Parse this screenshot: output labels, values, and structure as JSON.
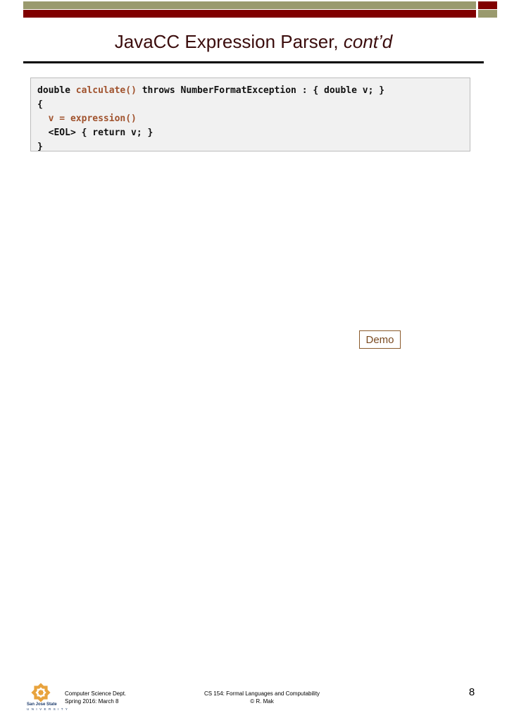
{
  "slide": {
    "title_main": "JavaCC Expression Parser, ",
    "title_italic": "cont’d",
    "page_number": "8"
  },
  "banner": {
    "olive_color": "#9a9a6e",
    "maroon_color": "#800000"
  },
  "code": {
    "line1_a": "double ",
    "line1_b": "calculate()",
    "line1_c": " throws NumberFormatException : { double v; }",
    "line2": "{",
    "line3_indent": "  ",
    "line3_b": "v = expression()",
    "line4_indent": "  ",
    "line4_b": "<EOL> { return v; }",
    "line5": "}",
    "highlight_color": "#a0522d",
    "plain_color": "#111111",
    "background_color": "#f1f1f1",
    "border_color": "#bcbcbc"
  },
  "demo": {
    "label": "Demo",
    "border_color": "#8a5a2b",
    "text_color": "#7a4a20"
  },
  "logo": {
    "name": "San Jose State",
    "sub": "U N I V E R S I T Y",
    "color": "#1b3a6b",
    "rosette_color": "#e8a33d"
  },
  "footer": {
    "dept_line1": "Computer Science Dept.",
    "dept_line2": "Spring 2016: March 8",
    "course_line1": "CS 154: Formal Languages and Computability",
    "course_line2": "© R. Mak"
  }
}
